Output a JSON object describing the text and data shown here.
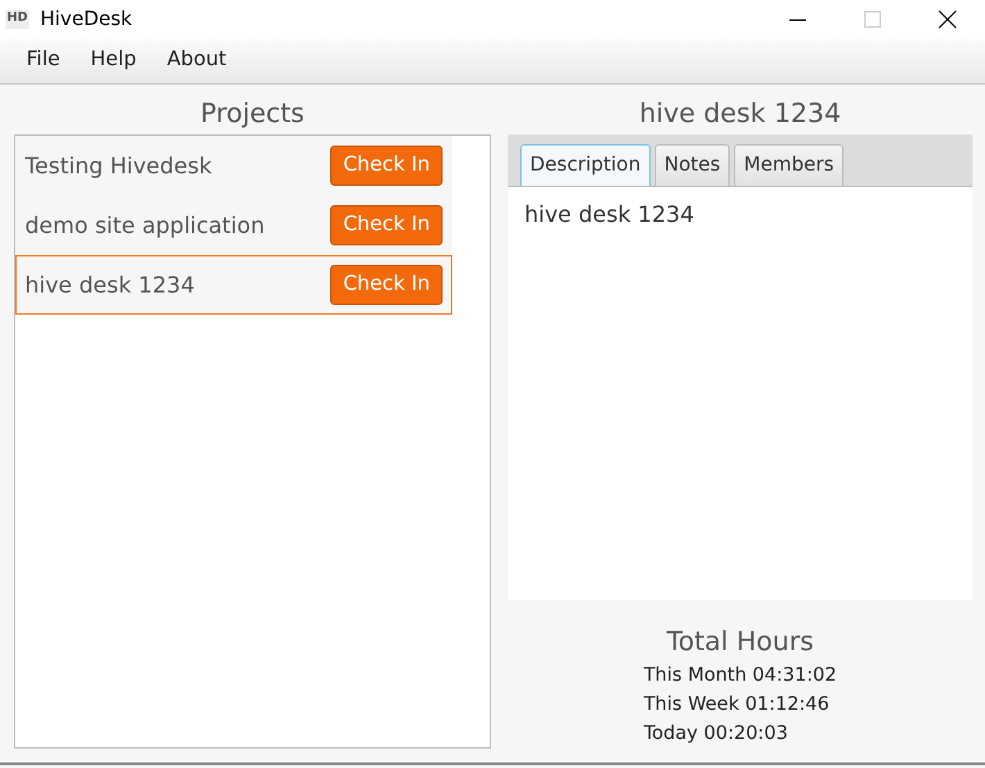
{
  "window": {
    "logo": "HD",
    "title": "HiveDesk",
    "maximize_disabled": true
  },
  "menu": [
    "File",
    "Help",
    "About"
  ],
  "projects": {
    "title": "Projects",
    "items": [
      {
        "name": "Testing Hivedesk",
        "button": "Check In",
        "selected": false
      },
      {
        "name": "demo site application",
        "button": "Check In",
        "selected": false
      },
      {
        "name": "hive desk 1234",
        "button": "Check In",
        "selected": true
      }
    ]
  },
  "detail": {
    "title": "hive desk 1234",
    "tabs": [
      {
        "label": "Description",
        "selected": true
      },
      {
        "label": "Notes",
        "selected": false
      },
      {
        "label": "Members",
        "selected": false
      }
    ],
    "content": "hive desk 1234"
  },
  "total_hours": {
    "title": "Total Hours",
    "lines": [
      "This Month 04:31:02",
      "This Week 01:12:46",
      "Today 00:20:03"
    ]
  }
}
